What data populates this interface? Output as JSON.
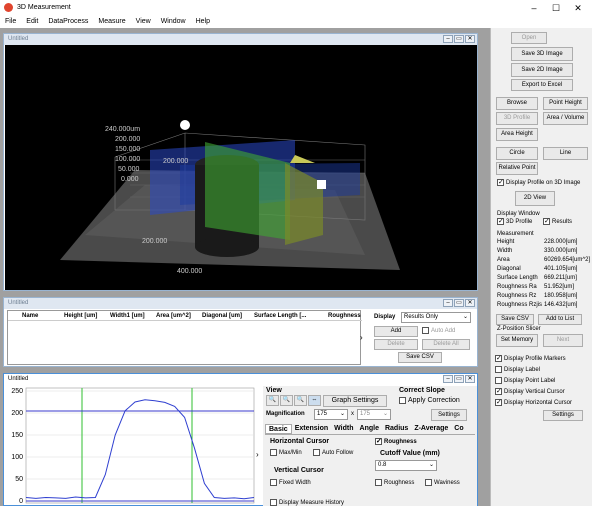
{
  "window": {
    "title": "3D Measurement"
  },
  "menu": [
    "File",
    "Edit",
    "DataProcess",
    "Measure",
    "View",
    "Window",
    "Help"
  ],
  "view3d": {
    "title": "Untitled",
    "z_ticks": [
      "240.000um",
      "200.000",
      "150.000",
      "100.000",
      "50.000",
      "0.000"
    ],
    "x_mid": "200.000",
    "x_front": "200.000",
    "y_front": "400.000"
  },
  "results": {
    "title": "Untitled",
    "columns": [
      "Name",
      "Height [um]",
      "Width1 [um]",
      "Area [um^2]",
      "Diagonal [um]",
      "Surface Length [...",
      "Roughness"
    ],
    "display_label": "Display",
    "display_value": "Results Only",
    "add": "Add",
    "auto_add": "Auto Add",
    "delete": "Delete",
    "delete_all": "Delete All",
    "save_csv": "Save CSV"
  },
  "profile": {
    "title": "Untitled",
    "y_ticks": [
      "250",
      "200",
      "150",
      "100",
      "50",
      "0"
    ],
    "view_label": "View",
    "graph_settings": "Graph Settings",
    "correct_slope": "Correct Slope",
    "apply_correction": "Apply Correction",
    "magnification_label": "Magnification",
    "mag_x": "175",
    "mag_sep": "x",
    "mag_y": "175",
    "settings": "Settings",
    "tabs": [
      "Basic",
      "Extension",
      "Width",
      "Angle",
      "Radius",
      "Z-Average",
      "Co"
    ],
    "horizontal_cursor": "Horizontal Cursor",
    "max_min": "Max/Min",
    "auto_follow": "Auto Follow",
    "roughness": "Roughness",
    "cutoff_label": "Cutoff Value (mm)",
    "cutoff_value": "0.8",
    "vertical_cursor": "Vertical Cursor",
    "fixed_width": "Fixed Width",
    "roughness2": "Roughness",
    "waviness": "Waviness",
    "display_measure_history": "Display Measure History"
  },
  "side": {
    "open": "Open",
    "save3d": "Save 3D Image",
    "save2d": "Save 2D Image",
    "export": "Export to Excel",
    "browse": "Browse",
    "point_height": "Point Height",
    "profile3d": "3D Profile",
    "area_volume": "Area / Volume",
    "area_height": "Area Height",
    "circle": "Circle",
    "line": "Line",
    "relative_point": "Relative Point",
    "display_profile_3d": "Display Profile on 3D Image",
    "view2d": "2D View",
    "display_window": "Display Window",
    "dw_3dprofile": "3D Profile",
    "dw_results": "Results",
    "measurement_label": "Measurement",
    "measurements": [
      {
        "k": "Height",
        "v": "228.000[um]"
      },
      {
        "k": "Width",
        "v": "330.000[um]"
      },
      {
        "k": "Area",
        "v": "60269.654[um^2]"
      },
      {
        "k": "Diagonal",
        "v": "401.105[um]"
      },
      {
        "k": "Surface Length",
        "v": "669.211[um]"
      },
      {
        "k": "Roughness  Ra",
        "v": "51.952[um]"
      },
      {
        "k": "Roughness  Rz",
        "v": "180.958[um]"
      },
      {
        "k": "Roughness  Rzjis",
        "v": "146.432[um]"
      }
    ],
    "save_csv": "Save CSV",
    "add_to_list": "Add to List",
    "zpos_label": "Z-Position Slicer",
    "set_memory": "Set Memory",
    "next": "Next",
    "opts": [
      {
        "t": "Display Profile Markers",
        "on": true
      },
      {
        "t": "Display Label",
        "on": false
      },
      {
        "t": "Display Point Label",
        "on": false
      },
      {
        "t": "Display Vertical Cursor",
        "on": true
      },
      {
        "t": "Display Horizontal Cursor",
        "on": true
      }
    ],
    "settings": "Settings"
  },
  "profile_curve": {
    "x": [
      0,
      10,
      20,
      30,
      40,
      50,
      60,
      70,
      80,
      90,
      100,
      110,
      120,
      130,
      140,
      150,
      160,
      170,
      180,
      190,
      200,
      210,
      220,
      230
    ],
    "y": [
      8,
      6,
      8,
      7,
      6,
      9,
      7,
      8,
      60,
      150,
      205,
      225,
      230,
      228,
      224,
      215,
      190,
      120,
      40,
      8,
      6,
      7,
      5,
      8
    ]
  }
}
